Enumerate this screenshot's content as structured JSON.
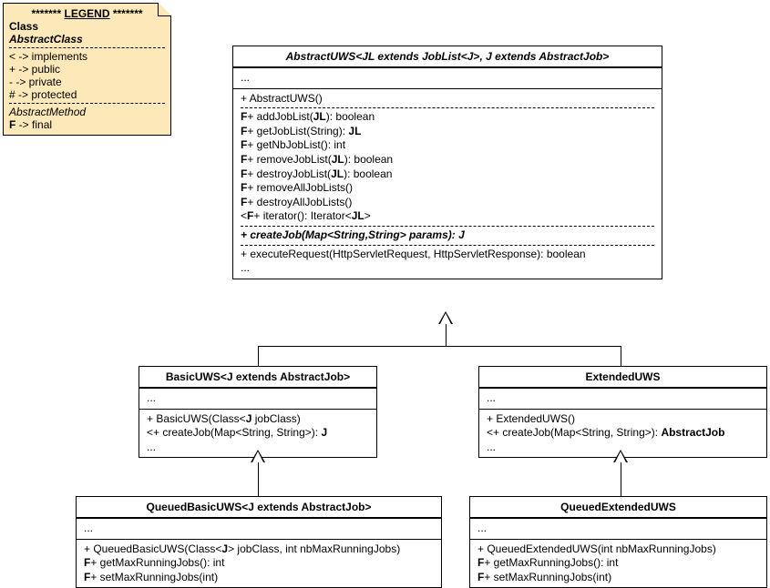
{
  "legend": {
    "heading_stars": "*******",
    "heading_word": "LEGEND",
    "class_label": "Class",
    "abstract_class_label": "AbstractClass",
    "lines": [
      "< -> implements",
      "+ -> public",
      "- -> private",
      "# -> protected"
    ],
    "abstract_method": "AbstractMethod",
    "final_label": "F -> final"
  },
  "abstractUWS": {
    "title": "AbstractUWS<JL extends JobList<J>, J extends AbstractJob>",
    "dots": "...",
    "ctor": "+ AbstractUWS()",
    "methods1": [
      "F+ addJobList(JL): boolean",
      "F+ getJobList(String): JL",
      "F+ getNbJobList(): int",
      "F+ removeJobList(JL): boolean",
      "F+ destroyJobList(JL): boolean",
      "F+ removeAllJobLists()",
      "F+ destroyAllJobLists()",
      "<F+ iterator(): Iterator<JL>"
    ],
    "abstract_method": "+ createJob(Map<String,String> params): J",
    "exec": "+ executeRequest(HttpServletRequest, HttpServletResponse): boolean",
    "dots2": "..."
  },
  "basicUWS": {
    "title": "BasicUWS<J extends AbstractJob>",
    "dots": "...",
    "ctor": "+ BasicUWS(Class<J jobClass)",
    "create": "<+ createJob(Map<String, String>): J",
    "dots2": "..."
  },
  "extendedUWS": {
    "title": "ExtendedUWS",
    "dots": "...",
    "ctor": "+ ExtendedUWS()",
    "create": "<+ createJob(Map<String, String>): AbstractJob",
    "dots2": "..."
  },
  "queuedBasic": {
    "title": "QueuedBasicUWS<J extends AbstractJob>",
    "dots": "...",
    "ctor": "+ QueuedBasicUWS(Class<J> jobClass, int nbMaxRunningJobs)",
    "get": "F+ getMaxRunningJobs(): int",
    "set": "F+ setMaxRunningJobs(int)"
  },
  "queuedExt": {
    "title": "QueuedExtendedUWS",
    "dots": "...",
    "ctor": "+ QueuedExtendedUWS(int nbMaxRunningJobs)",
    "get": "F+ getMaxRunningJobs(): int",
    "set": "F+ setMaxRunningJobs(int)"
  },
  "chart_data": {
    "type": "uml-class-diagram",
    "classes": [
      {
        "name": "AbstractUWS",
        "generics": "JL extends JobList<J>, J extends AbstractJob",
        "abstract": true,
        "attributes": [
          "..."
        ],
        "members": [
          {
            "text": "+ AbstractUWS()",
            "kind": "constructor"
          },
          {
            "text": "F+ addJobList(JL): boolean",
            "final": true,
            "visibility": "public"
          },
          {
            "text": "F+ getJobList(String): JL",
            "final": true,
            "visibility": "public"
          },
          {
            "text": "F+ getNbJobList(): int",
            "final": true,
            "visibility": "public"
          },
          {
            "text": "F+ removeJobList(JL): boolean",
            "final": true,
            "visibility": "public"
          },
          {
            "text": "F+ destroyJobList(JL): boolean",
            "final": true,
            "visibility": "public"
          },
          {
            "text": "F+ removeAllJobLists()",
            "final": true,
            "visibility": "public"
          },
          {
            "text": "F+ destroyAllJobLists()",
            "final": true,
            "visibility": "public"
          },
          {
            "text": "<F+ iterator(): Iterator<JL>",
            "final": true,
            "implements": true,
            "visibility": "public"
          },
          {
            "text": "+ createJob(Map<String,String> params): J",
            "abstract": true,
            "visibility": "public"
          },
          {
            "text": "+ executeRequest(HttpServletRequest, HttpServletResponse): boolean",
            "visibility": "public"
          },
          {
            "text": "..."
          }
        ]
      },
      {
        "name": "BasicUWS",
        "generics": "J extends AbstractJob",
        "extends": "AbstractUWS",
        "attributes": [
          "..."
        ],
        "members": [
          {
            "text": "+ BasicUWS(Class<J jobClass)",
            "kind": "constructor"
          },
          {
            "text": "<+ createJob(Map<String, String>): J",
            "implements": true,
            "visibility": "public"
          },
          {
            "text": "..."
          }
        ]
      },
      {
        "name": "ExtendedUWS",
        "extends": "AbstractUWS",
        "attributes": [
          "..."
        ],
        "members": [
          {
            "text": "+ ExtendedUWS()",
            "kind": "constructor"
          },
          {
            "text": "<+ createJob(Map<String, String>): AbstractJob",
            "implements": true,
            "visibility": "public"
          },
          {
            "text": "..."
          }
        ]
      },
      {
        "name": "QueuedBasicUWS",
        "generics": "J extends AbstractJob",
        "extends": "BasicUWS",
        "attributes": [
          "..."
        ],
        "members": [
          {
            "text": "+ QueuedBasicUWS(Class<J> jobClass, int nbMaxRunningJobs)",
            "kind": "constructor"
          },
          {
            "text": "F+ getMaxRunningJobs(): int",
            "final": true,
            "visibility": "public"
          },
          {
            "text": "F+ setMaxRunningJobs(int)",
            "final": true,
            "visibility": "public"
          }
        ]
      },
      {
        "name": "QueuedExtendedUWS",
        "extends": "ExtendedUWS",
        "attributes": [
          "..."
        ],
        "members": [
          {
            "text": "+ QueuedExtendedUWS(int nbMaxRunningJobs)",
            "kind": "constructor"
          },
          {
            "text": "F+ getMaxRunningJobs(): int",
            "final": true,
            "visibility": "public"
          },
          {
            "text": "F+ setMaxRunningJobs(int)",
            "final": true,
            "visibility": "public"
          }
        ]
      }
    ],
    "relations": [
      {
        "from": "BasicUWS",
        "to": "AbstractUWS",
        "type": "generalization"
      },
      {
        "from": "ExtendedUWS",
        "to": "AbstractUWS",
        "type": "generalization"
      },
      {
        "from": "QueuedBasicUWS",
        "to": "BasicUWS",
        "type": "generalization"
      },
      {
        "from": "QueuedExtendedUWS",
        "to": "ExtendedUWS",
        "type": "generalization"
      }
    ]
  }
}
